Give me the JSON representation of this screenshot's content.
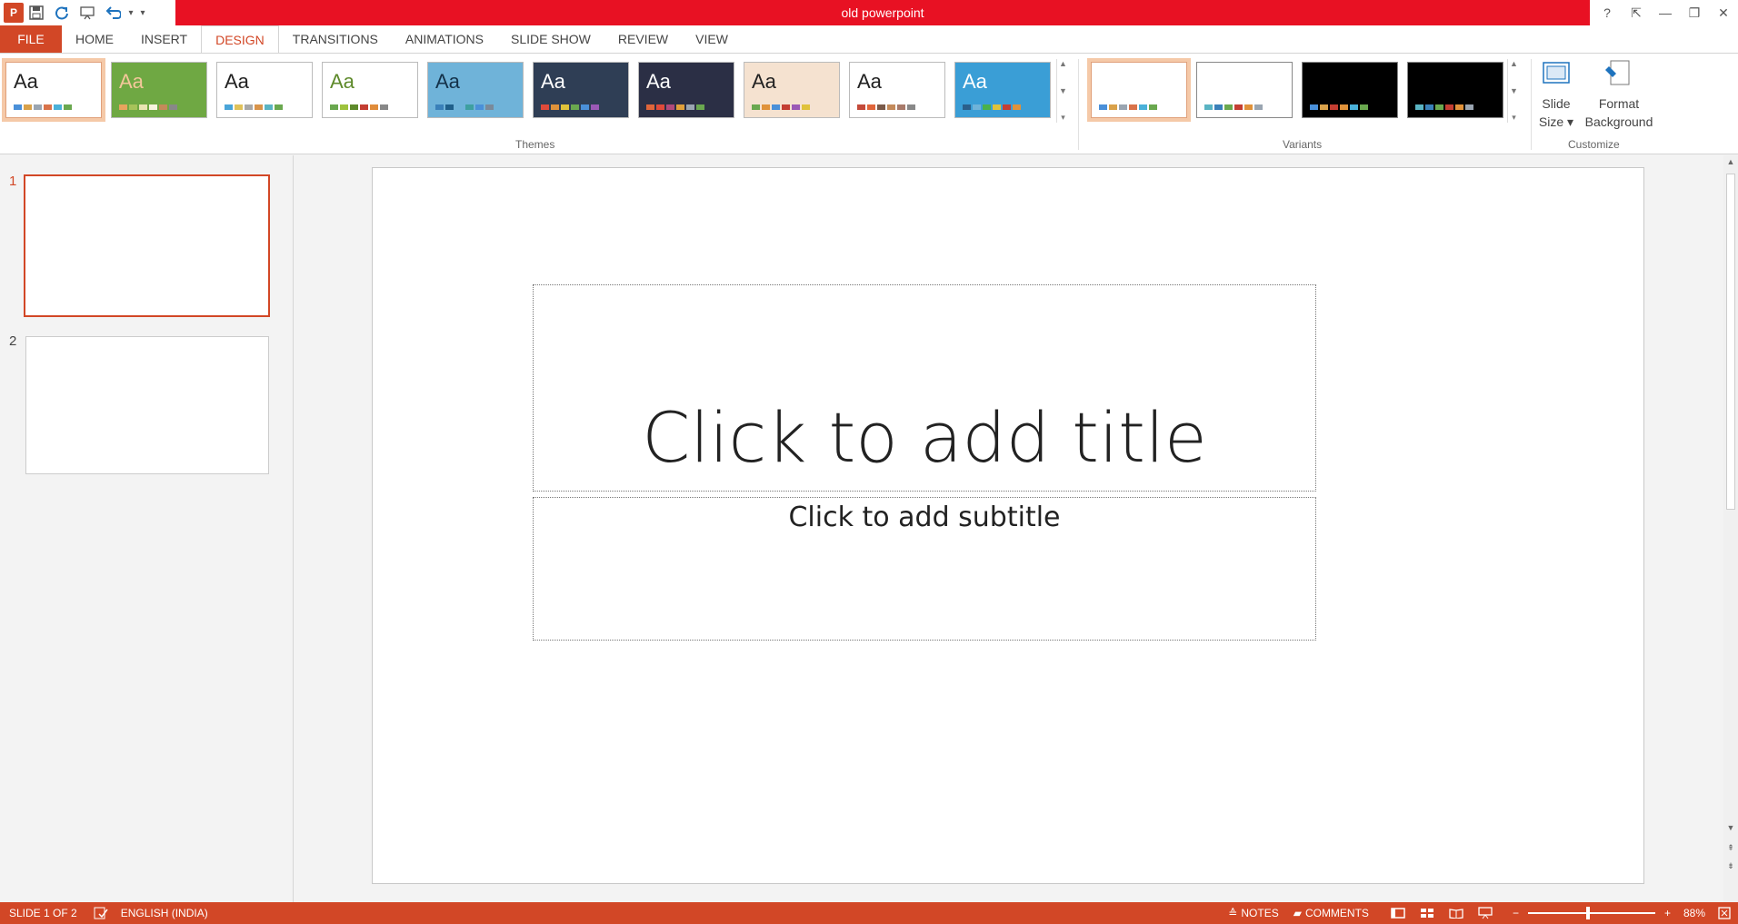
{
  "window": {
    "title": "old powerpoint",
    "help": "?",
    "restore_ribbon": "⇱",
    "minimize": "—",
    "restore": "❐",
    "close": "✕"
  },
  "qat": {
    "app_icon": "P",
    "save_icon": "floppy-icon",
    "repeat_icon": "repeat-icon",
    "present_icon": "present-icon",
    "undo_icon": "undo-icon",
    "customize": "▾"
  },
  "tabs": [
    "FILE",
    "HOME",
    "INSERT",
    "DESIGN",
    "TRANSITIONS",
    "ANIMATIONS",
    "SLIDE SHOW",
    "REVIEW",
    "VIEW"
  ],
  "active_tab": "DESIGN",
  "ribbon": {
    "themes_label": "Themes",
    "variants_label": "Variants",
    "customize_label": "Customize",
    "theme_aa": "Aa",
    "slide_size_line1": "Slide",
    "slide_size_line2": "Size",
    "format_bg_line1": "Format",
    "format_bg_line2": "Background"
  },
  "themes": [
    {
      "bg": "#ffffff",
      "fg": "#222222",
      "sw": [
        "#4a90d9",
        "#d9a14a",
        "#9aa5b1",
        "#d9734a",
        "#4ab1d9",
        "#6aa84f"
      ]
    },
    {
      "bg": "#6fa843",
      "fg": "#f3c79a",
      "sw": [
        "#e7a45e",
        "#a7c35a",
        "#e9e4b2",
        "#f7f3df",
        "#c48a5a",
        "#888888"
      ]
    },
    {
      "bg": "#ffffff",
      "fg": "#222222",
      "sw": [
        "#4aa5d9",
        "#e0c25a",
        "#a8a8a8",
        "#d9944a",
        "#5ab4c3",
        "#6aa84f"
      ]
    },
    {
      "bg": "#ffffff",
      "fg": "#5e8a2b",
      "sw": [
        "#6aa84f",
        "#9ec23d",
        "#5e8a2b",
        "#c43e32",
        "#e08c3a",
        "#888888"
      ]
    },
    {
      "bg": "#6fb3d9",
      "fg": "#14324a",
      "sw": [
        "#3a80b9",
        "#1f5f8a",
        "#6fb3d9",
        "#3ea0a0",
        "#4a90d9",
        "#7a8a9a"
      ]
    },
    {
      "bg": "#2f3e55",
      "fg": "#ffffff",
      "sw": [
        "#e04a3a",
        "#e0923a",
        "#e0c23a",
        "#6aa84f",
        "#4a90d9",
        "#9b59b6"
      ]
    },
    {
      "bg": "#2b2f45",
      "fg": "#ffffff",
      "sw": [
        "#e0653a",
        "#e04a3a",
        "#b04a7a",
        "#e0a03a",
        "#9aa5b1",
        "#6aa84f"
      ]
    },
    {
      "bg": "#f5e2d0",
      "fg": "#222222",
      "sw": [
        "#6aa84f",
        "#e0923a",
        "#4a90d9",
        "#c43e32",
        "#9b59b6",
        "#e0c23a"
      ]
    },
    {
      "bg": "#ffffff",
      "fg": "#222222",
      "sw": [
        "#c44a3a",
        "#e0653a",
        "#7a5a4a",
        "#c48a5a",
        "#a87a6a",
        "#888888"
      ]
    },
    {
      "bg": "#3a9ed6",
      "fg": "#ffffff",
      "sw": [
        "#2b5f8a",
        "#6fb3d9",
        "#4ab14a",
        "#e0c23a",
        "#c43e32",
        "#e0923a"
      ]
    }
  ],
  "variants": [
    {
      "bg": "#ffffff",
      "sw": [
        "#4a90d9",
        "#d9a14a",
        "#9aa5b1",
        "#d9734a",
        "#4ab1d9",
        "#6aa84f"
      ]
    },
    {
      "bg": "#ffffff",
      "sw": [
        "#5ab4c3",
        "#3a80b9",
        "#6aa84f",
        "#c43e32",
        "#e0923a",
        "#9aa5b1"
      ]
    },
    {
      "bg": "#000000",
      "sw": [
        "#4a90d9",
        "#d9a14a",
        "#c43e32",
        "#e0923a",
        "#4ab1d9",
        "#6aa84f"
      ]
    },
    {
      "bg": "#000000",
      "sw": [
        "#5ab4c3",
        "#3a80b9",
        "#6aa84f",
        "#c43e32",
        "#e0923a",
        "#9aa5b1"
      ]
    }
  ],
  "slides": [
    {
      "number": "1"
    },
    {
      "number": "2"
    }
  ],
  "slide": {
    "title_placeholder": "Click to add title",
    "subtitle_placeholder": "Click to add subtitle"
  },
  "status": {
    "slide_counter": "SLIDE 1 OF 2",
    "language": "ENGLISH (INDIA)",
    "notes": "NOTES",
    "comments": "COMMENTS",
    "zoom_minus": "−",
    "zoom_plus": "+",
    "zoom_level": "88%",
    "zoom_fraction": 0.47
  },
  "colors": {
    "accent": "#d24726",
    "title_bar": "#e81123"
  }
}
